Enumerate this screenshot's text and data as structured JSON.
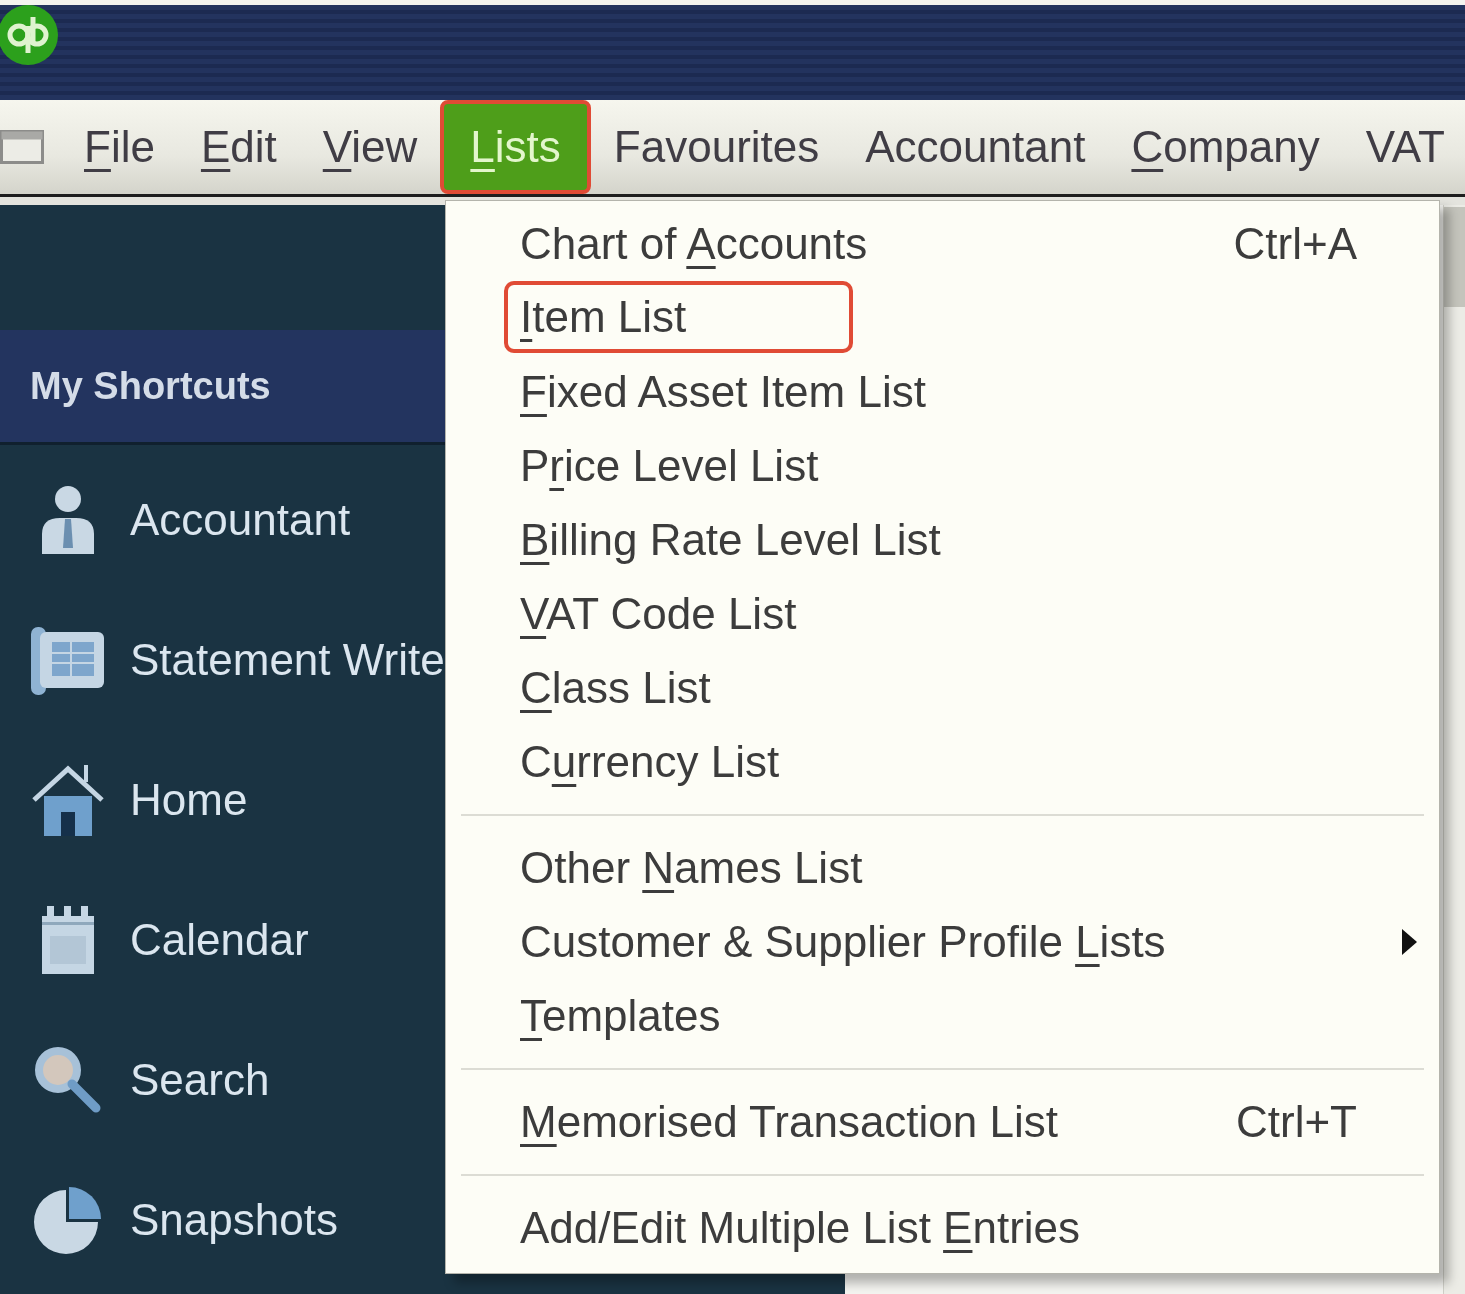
{
  "menu_bar": {
    "items": [
      {
        "key": "F",
        "rest": "ile",
        "selected": false,
        "highlighted": false
      },
      {
        "key": "E",
        "rest": "dit",
        "selected": false,
        "highlighted": false
      },
      {
        "key": "V",
        "rest": "iew",
        "selected": false,
        "highlighted": false
      },
      {
        "key": "L",
        "rest": "ists",
        "selected": true,
        "highlighted": true
      },
      {
        "label": "Favourites",
        "selected": false,
        "highlighted": false
      },
      {
        "label": "Accountant",
        "selected": false,
        "highlighted": false
      },
      {
        "key": "C",
        "rest": "ompany",
        "selected": false,
        "highlighted": false
      },
      {
        "label": "VAT",
        "selected": false,
        "highlighted": false
      }
    ]
  },
  "sidebar": {
    "heading": "My Shortcuts",
    "items": [
      {
        "label": "Accountant"
      },
      {
        "label": "Statement Write"
      },
      {
        "label": "Home"
      },
      {
        "label": "Calendar"
      },
      {
        "label": "Search"
      },
      {
        "label": "Snapshots"
      }
    ]
  },
  "lists_menu": {
    "sections": [
      {
        "items": [
          {
            "label": "Chart of ",
            "key": "A",
            "rest": "ccounts",
            "shortcut": "Ctrl+A",
            "submenu": false,
            "highlighted": false
          },
          {
            "key": "I",
            "rest": "tem List",
            "submenu": false,
            "highlighted": true
          },
          {
            "key": "F",
            "rest": "ixed Asset Item List",
            "submenu": false,
            "highlighted": false
          },
          {
            "label": "P",
            "key": "r",
            "rest": "ice Level List",
            "submenu": false,
            "highlighted": false
          },
          {
            "key": "B",
            "rest": "illing Rate Level List",
            "submenu": false,
            "highlighted": false
          },
          {
            "key": "V",
            "rest": "AT Code List",
            "submenu": false,
            "highlighted": false
          },
          {
            "key": "C",
            "rest": "lass List",
            "submenu": false,
            "highlighted": false
          },
          {
            "label": "C",
            "key": "u",
            "rest": "rrency List",
            "submenu": false,
            "highlighted": false
          }
        ]
      },
      {
        "items": [
          {
            "label": "Other ",
            "key": "N",
            "rest": "ames List",
            "submenu": false,
            "highlighted": false
          },
          {
            "label": "Customer & Supplier Profile ",
            "key": "L",
            "rest": "ists",
            "submenu": true,
            "highlighted": false
          },
          {
            "key": "T",
            "rest": "emplates",
            "submenu": false,
            "highlighted": false
          }
        ]
      },
      {
        "items": [
          {
            "key": "M",
            "rest": "emorised Transaction List",
            "shortcut": "Ctrl+T",
            "submenu": false,
            "highlighted": false
          }
        ]
      },
      {
        "items": [
          {
            "label": "Add/Edit Multiple List ",
            "key": "E",
            "rest": "ntries",
            "submenu": false,
            "highlighted": false
          }
        ]
      }
    ]
  }
}
